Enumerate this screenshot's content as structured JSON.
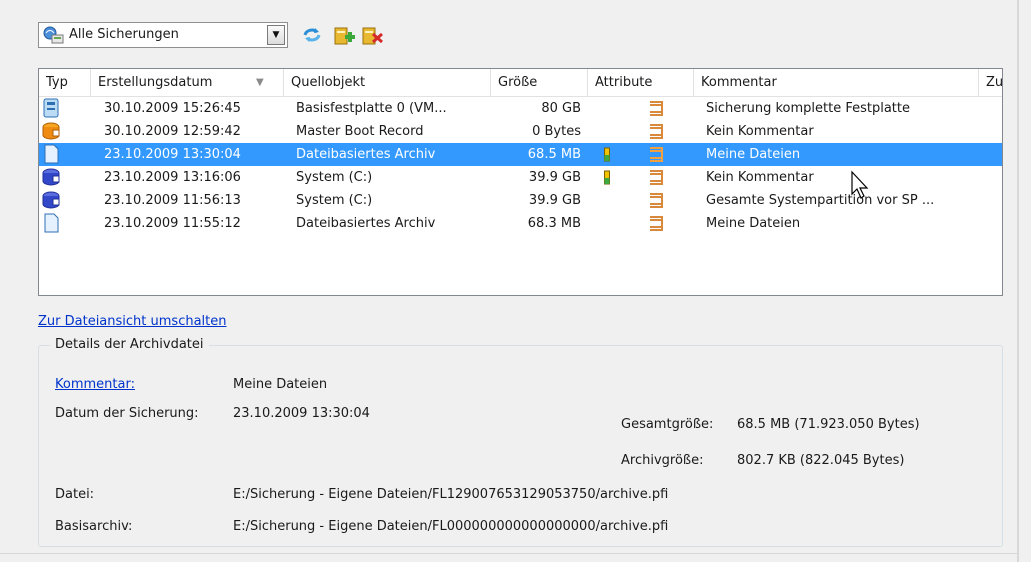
{
  "toolbar": {
    "filter_value": "Alle Sicherungen",
    "buttons": [
      {
        "icon": "refresh-icon"
      },
      {
        "icon": "add-archive-icon"
      },
      {
        "icon": "delete-archive-icon"
      }
    ]
  },
  "table": {
    "columns": [
      "Typ",
      "Erstellungsdatum",
      "Quellobjekt",
      "Größe",
      "Attribute",
      "Kommentar",
      "Zu"
    ],
    "sorted_column": "Erstellungsdatum",
    "selected_index": 2,
    "rows": [
      {
        "type_icon": "disk-image-icon",
        "date": "30.10.2009 15:26:45",
        "source": "Basisfestplatte 0 (VM...",
        "size": "80 GB",
        "comment": "Sicherung komplette Festplatte"
      },
      {
        "type_icon": "mbr-icon",
        "date": "30.10.2009 12:59:42",
        "source": "Master Boot Record",
        "size": "0 Bytes",
        "comment": "Kein Kommentar"
      },
      {
        "type_icon": "file-archive-icon",
        "date": "23.10.2009 13:30:04",
        "source": "Dateibasiertes Archiv",
        "size": "68.5 MB",
        "comment": "Meine Dateien"
      },
      {
        "type_icon": "partition-icon",
        "date": "23.10.2009 13:16:06",
        "source": "System (C:)",
        "size": "39.9 GB",
        "comment": "Kein Kommentar"
      },
      {
        "type_icon": "partition-icon",
        "date": "23.10.2009 11:56:13",
        "source": "System (C:)",
        "size": "39.9 GB",
        "comment": "Gesamte Systempartition vor SP ..."
      },
      {
        "type_icon": "file-archive-icon",
        "date": "23.10.2009 11:55:12",
        "source": "Dateibasiertes Archiv",
        "size": "68.3 MB",
        "comment": "Meine Dateien"
      }
    ]
  },
  "switch_view_link": "Zur Dateiansicht umschalten",
  "details": {
    "group_title": "Details der Archivdatei",
    "comment_label": "Kommentar:",
    "comment_value": "Meine Dateien",
    "date_label": "Datum der Sicherung:",
    "date_value": "23.10.2009 13:30:04",
    "total_size_label": "Gesamtgröße:",
    "total_size_value": "68.5 MB (71.923.050 Bytes)",
    "archive_size_label": "Archivgröße:",
    "archive_size_value": "802.7 KB (822.045 Bytes)",
    "file_label": "Datei:",
    "file_value": "E:/Sicherung - Eigene Dateien/FL129007653129053750/archive.pfi",
    "base_label": "Basisarchiv:",
    "base_value": "E:/Sicherung - Eigene Dateien/FL000000000000000000/archive.pfi"
  }
}
